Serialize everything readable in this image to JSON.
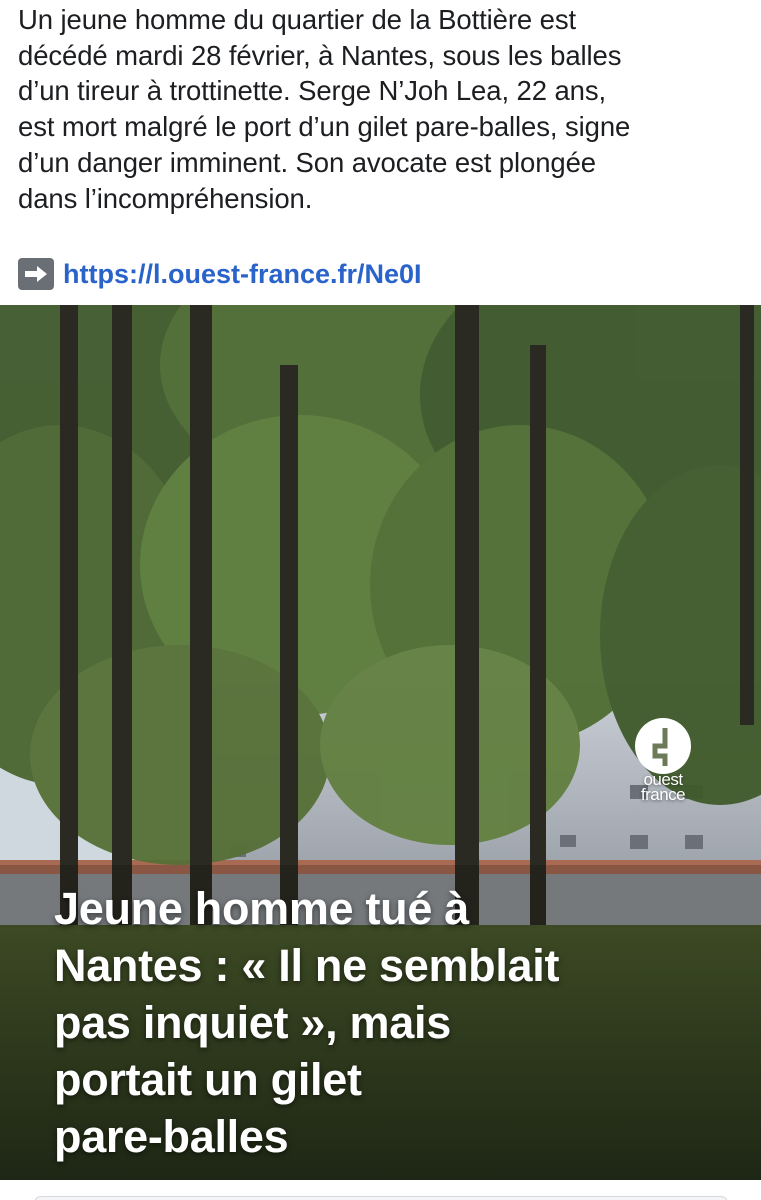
{
  "post": {
    "text_lines": [
      "Un jeune homme du quartier de la Bottière est",
      "décédé mardi 28 février, à Nantes, sous les balles",
      "d’un tireur à trottinette. Serge N’Joh Lea, 22 ans,",
      "est mort malgré le port d’un gilet pare-balles, signe",
      "d’un danger imminent. Son avocate est plongée",
      "dans l’incompréhension."
    ],
    "arrow_icon": "right-arrow-emoji",
    "link": "https://l.ouest-france.fr/Ne0I"
  },
  "card": {
    "headline_lines": [
      "Jeune homme tué à",
      "Nantes : « Il ne semblait",
      "pas inquiet », mais",
      "portait un gilet",
      "pare-balles"
    ],
    "logo_text_line1": "ouest",
    "logo_text_line2": "france"
  },
  "colors": {
    "text": "#1c1e21",
    "link": "#2a63c9",
    "headline": "#ffffff"
  }
}
